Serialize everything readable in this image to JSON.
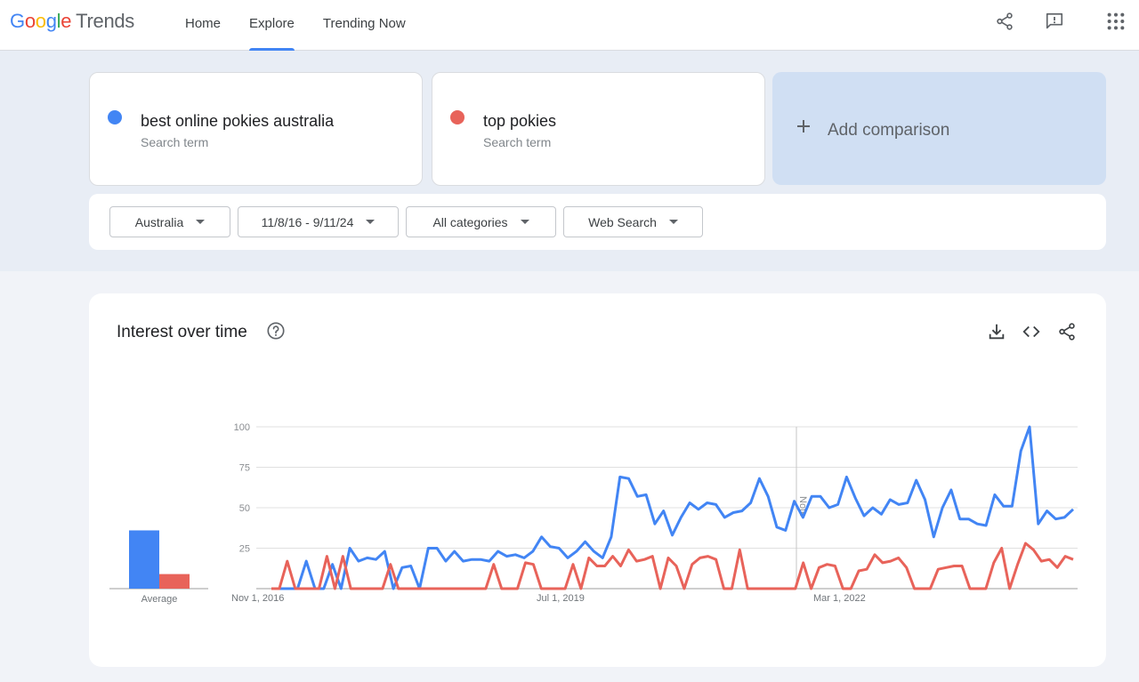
{
  "app": {
    "logo_google": "Google",
    "logo_trends": "Trends",
    "nav": [
      {
        "label": "Home",
        "active": false
      },
      {
        "label": "Explore",
        "active": true
      },
      {
        "label": "Trending Now",
        "active": false
      }
    ],
    "header_icons": [
      "share-icon",
      "feedback-icon",
      "apps-grid-icon"
    ]
  },
  "terms": [
    {
      "label": "best online pokies australia",
      "sub": "Search term",
      "color": "#4285f4"
    },
    {
      "label": "top pokies",
      "sub": "Search term",
      "color": "#e8635a"
    }
  ],
  "add_comparison": {
    "label": "Add comparison"
  },
  "filters": {
    "region": "Australia",
    "date_range": "11/8/16 - 9/11/24",
    "category": "All categories",
    "search_type": "Web Search"
  },
  "chart_card": {
    "title": "Interest over time",
    "icons": [
      "help-icon",
      "download-icon",
      "embed-icon",
      "share-icon"
    ]
  },
  "chart_data": {
    "type": "line",
    "title": "Interest over time",
    "ylim": [
      0,
      100
    ],
    "y_ticks": [
      "100",
      "75",
      "50",
      "25"
    ],
    "x_tick_labels": [
      "Nov 1, 2016",
      "Jul 1, 2019",
      "Mar 1, 2022"
    ],
    "annotation": "Note",
    "average_label": "Average",
    "averages": [
      36,
      9
    ],
    "grid": true,
    "series": [
      {
        "name": "best online pokies australia",
        "color": "#4285f4",
        "values": [
          0,
          0,
          0,
          0,
          17,
          0,
          0,
          15,
          0,
          25,
          17,
          19,
          18,
          23,
          0,
          13,
          14,
          0,
          25,
          25,
          17,
          23,
          17,
          18,
          18,
          17,
          23,
          20,
          21,
          19,
          23,
          32,
          26,
          25,
          19,
          23,
          29,
          23,
          19,
          32,
          69,
          68,
          57,
          58,
          40,
          48,
          33,
          44,
          53,
          49,
          53,
          52,
          44,
          47,
          48,
          53,
          68,
          57,
          38,
          36,
          54,
          44,
          57,
          57,
          50,
          52,
          69,
          56,
          45,
          50,
          46,
          55,
          52,
          53,
          67,
          55,
          32,
          50,
          61,
          43,
          43,
          40,
          39,
          58,
          51,
          51,
          85,
          100,
          40,
          48,
          43,
          44,
          49
        ]
      },
      {
        "name": "top pokies",
        "color": "#e8635a",
        "values": [
          0,
          0,
          17,
          0,
          0,
          0,
          0,
          20,
          0,
          20,
          0,
          0,
          0,
          0,
          0,
          15,
          0,
          0,
          0,
          0,
          0,
          0,
          0,
          0,
          0,
          0,
          0,
          0,
          15,
          0,
          0,
          0,
          16,
          15,
          0,
          0,
          0,
          0,
          15,
          0,
          19,
          14,
          14,
          20,
          14,
          24,
          17,
          18,
          20,
          0,
          19,
          14,
          0,
          15,
          19,
          20,
          18,
          0,
          0,
          24,
          0,
          0,
          0,
          0,
          0,
          0,
          0,
          16,
          0,
          13,
          15,
          14,
          0,
          0,
          11,
          12,
          21,
          16,
          17,
          19,
          13,
          0,
          0,
          0,
          12,
          13,
          14,
          14,
          0,
          0,
          0,
          16,
          25,
          0,
          15,
          28,
          24,
          17,
          18,
          13,
          20,
          18
        ]
      }
    ]
  }
}
